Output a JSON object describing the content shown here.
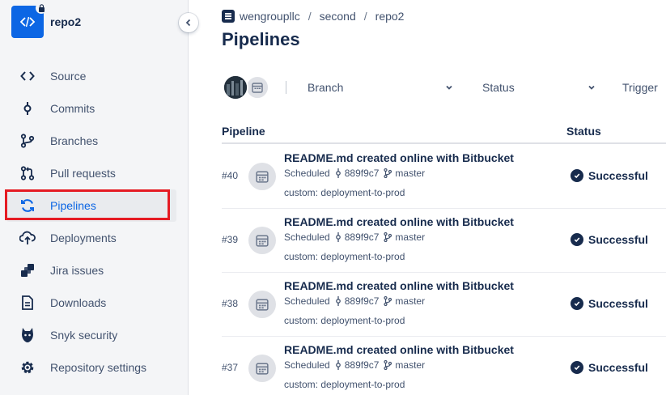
{
  "sidebar": {
    "repo_name": "repo2",
    "items": [
      {
        "label": "Source",
        "icon": "code-icon"
      },
      {
        "label": "Commits",
        "icon": "commit-icon"
      },
      {
        "label": "Branches",
        "icon": "branch-icon"
      },
      {
        "label": "Pull requests",
        "icon": "pull-request-icon"
      },
      {
        "label": "Pipelines",
        "icon": "pipelines-icon",
        "active": true
      },
      {
        "label": "Deployments",
        "icon": "deployments-icon"
      },
      {
        "label": "Jira issues",
        "icon": "jira-icon"
      },
      {
        "label": "Downloads",
        "icon": "downloads-icon"
      },
      {
        "label": "Snyk security",
        "icon": "snyk-icon"
      },
      {
        "label": "Repository settings",
        "icon": "gear-icon"
      }
    ]
  },
  "breadcrumb": {
    "workspace": "wengroupllc",
    "project": "second",
    "repo": "repo2"
  },
  "page": {
    "title": "Pipelines"
  },
  "filters": {
    "branch_label": "Branch",
    "status_label": "Status",
    "trigger_label": "Trigger"
  },
  "table": {
    "col_pipeline": "Pipeline",
    "col_status": "Status",
    "rows": [
      {
        "number": "#40",
        "title": "README.md created online with Bitbucket",
        "trigger": "Scheduled",
        "commit": "889f9c7",
        "branch": "master",
        "custom": "custom: deployment-to-prod",
        "status": "Successful"
      },
      {
        "number": "#39",
        "title": "README.md created online with Bitbucket",
        "trigger": "Scheduled",
        "commit": "889f9c7",
        "branch": "master",
        "custom": "custom: deployment-to-prod",
        "status": "Successful"
      },
      {
        "number": "#38",
        "title": "README.md created online with Bitbucket",
        "trigger": "Scheduled",
        "commit": "889f9c7",
        "branch": "master",
        "custom": "custom: deployment-to-prod",
        "status": "Successful"
      },
      {
        "number": "#37",
        "title": "README.md created online with Bitbucket",
        "trigger": "Scheduled",
        "commit": "889f9c7",
        "branch": "master",
        "custom": "custom: deployment-to-prod",
        "status": "Successful"
      }
    ]
  },
  "colors": {
    "accent": "#0c66e4",
    "highlight": "#e51b23",
    "sidebar_bg": "#f4f5f7"
  }
}
